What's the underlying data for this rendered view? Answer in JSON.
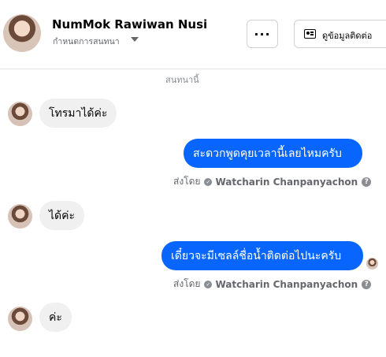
{
  "header": {
    "name": "NumMok Rawiwan Nusi",
    "subtitle": "กำหนดการสนทนา",
    "more_label": "···",
    "contact_label": "ดูข้อมูลติดต่อ"
  },
  "meta_top": "สนทนานี้",
  "messages": [
    {
      "direction": "in",
      "text": "โทรมาได้ค่ะ"
    },
    {
      "direction": "out",
      "text": "สะดวกพูดคุยเวลานี้เลยไหมครับ",
      "sent_by_label": "ส่งโดย",
      "sender": "Watcharin Chanpanyachon"
    },
    {
      "direction": "in",
      "text": "ได้ค่ะ"
    },
    {
      "direction": "out",
      "text": "เดี๋ยวจะมีเซลล์ชื่อน้ำติดต่อไปนะครับ",
      "sent_by_label": "ส่งโดย",
      "sender": "Watcharin Chanpanyachon"
    },
    {
      "direction": "in",
      "text": "ค่ะ"
    }
  ],
  "colors": {
    "outgoing_bubble": "#0866ff",
    "incoming_bubble": "#f0f0f0"
  },
  "icons": {
    "more": "more-horizontal-icon",
    "contact": "contact-card-icon",
    "verified": "verified-check-icon",
    "help": "help-circle-icon"
  }
}
